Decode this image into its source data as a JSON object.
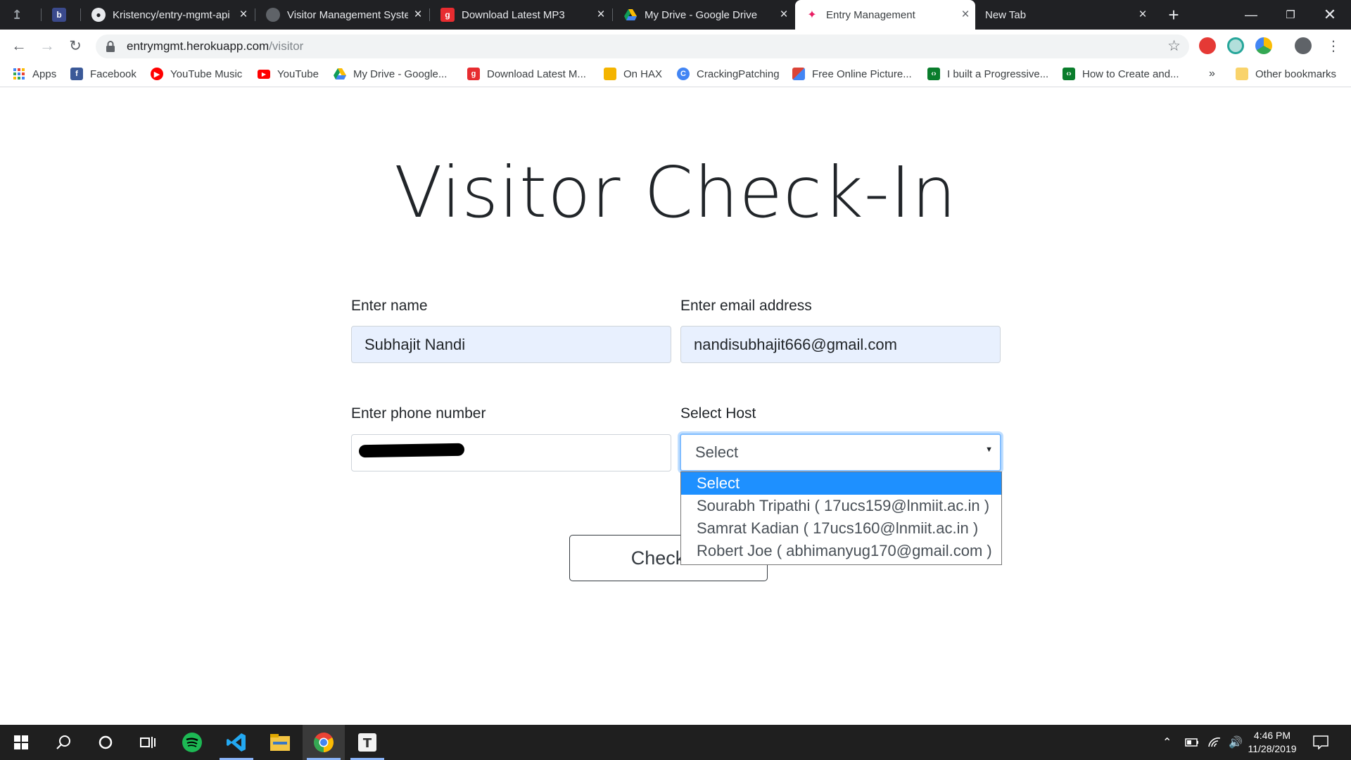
{
  "browser": {
    "tabs": [
      {
        "label": "",
        "icon": "blogger-favicon"
      },
      {
        "label": "",
        "icon": "bookmark-favicon"
      },
      {
        "label": "Kristency/entry-mgmt-api",
        "icon": "github-favicon"
      },
      {
        "label": "Visitor Management System",
        "icon": "globe-favicon"
      },
      {
        "label": "Download Latest MP3",
        "icon": "gaana-favicon"
      },
      {
        "label": "My Drive - Google Drive",
        "icon": "google-drive-favicon"
      },
      {
        "label": "Entry Management",
        "icon": "feather-favicon"
      },
      {
        "label": "New Tab",
        "icon": ""
      }
    ],
    "active_tab_index": 6,
    "url": {
      "host": "entrymgmt.herokuapp.com",
      "path": "/visitor"
    },
    "bookmarks": [
      {
        "label": "Apps",
        "icon": "apps-grid-icon",
        "color": "#1a73e8"
      },
      {
        "label": "Facebook",
        "icon": "facebook-icon",
        "color": "#3b5998"
      },
      {
        "label": "YouTube Music",
        "icon": "youtube-music-icon",
        "color": "#ff0000"
      },
      {
        "label": "YouTube",
        "icon": "youtube-icon",
        "color": "#ff0000"
      },
      {
        "label": "My Drive - Google...",
        "icon": "google-drive-icon",
        "color": "#0f9d58"
      },
      {
        "label": "Download Latest M...",
        "icon": "gaana-icon",
        "color": "#e72c30"
      },
      {
        "label": "On HAX",
        "icon": "folder-icon",
        "color": "#f4b400"
      },
      {
        "label": "CrackingPatching",
        "icon": "cracking-icon",
        "color": "#4285f4"
      },
      {
        "label": "Free Online Picture...",
        "icon": "picture-icon",
        "color": "#db4437"
      },
      {
        "label": "I built a Progressive...",
        "icon": "dev-icon",
        "color": "#0a7d2c"
      },
      {
        "label": "How to Create and...",
        "icon": "dev-icon",
        "color": "#0a7d2c"
      }
    ],
    "other_bookmarks": "Other bookmarks",
    "overflow": "»"
  },
  "page": {
    "title": "Visitor Check-In",
    "name_label": "Enter name",
    "name_value": "Subhajit Nandi",
    "email_label": "Enter email address",
    "email_value": "nandisubhajit666@gmail.com",
    "phone_label": "Enter phone number",
    "host_label": "Select Host",
    "host_selected": "Select",
    "host_options": [
      "Select",
      "Sourabh Tripathi ( 17ucs159@lnmiit.ac.in )",
      "Samrat Kadian ( 17ucs160@lnmiit.ac.in )",
      "Robert Joe ( abhimanyug170@gmail.com )"
    ],
    "checkin_button": "Check In"
  },
  "taskbar": {
    "time": "4:46 PM",
    "date": "11/28/2019",
    "apps": [
      "start-icon",
      "search-icon",
      "cortana-icon",
      "task-view-icon",
      "spotify-icon",
      "vscode-icon",
      "file-explorer-icon",
      "chrome-icon",
      "typora-icon"
    ]
  }
}
